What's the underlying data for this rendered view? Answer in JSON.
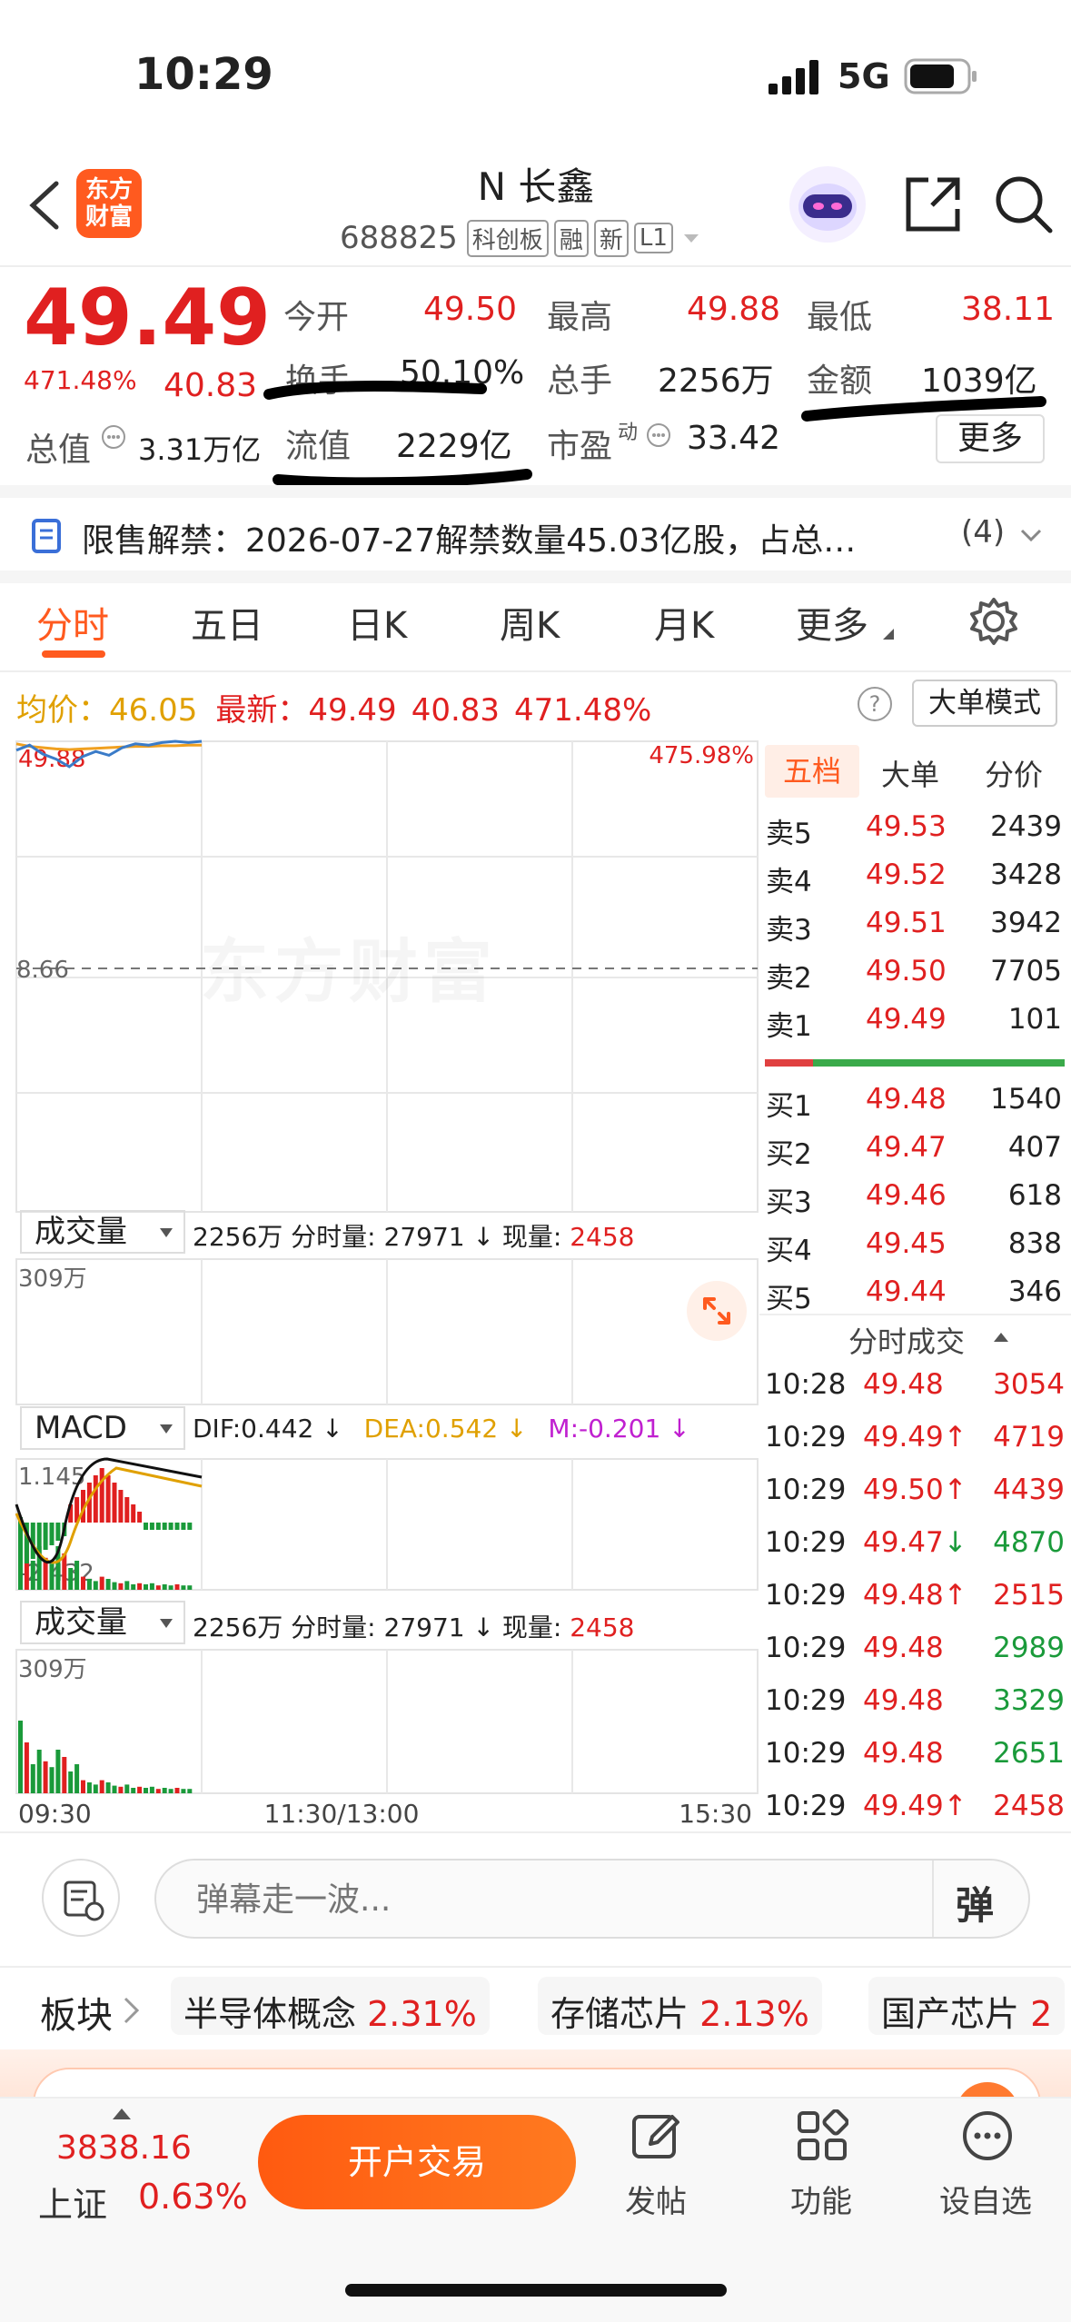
{
  "status": {
    "time": "10:29",
    "network": "5G"
  },
  "header": {
    "title": "N 长鑫",
    "code": "688825",
    "tags": [
      "科创板",
      "融",
      "新",
      "L1"
    ],
    "logo_line1": "东方",
    "logo_line2": "财富"
  },
  "quote": {
    "price": "49.49",
    "change_pct": "471.48%",
    "change": "40.83",
    "open_label": "今开",
    "open": "49.50",
    "high_label": "最高",
    "high": "49.88",
    "low_label": "最低",
    "low": "38.11",
    "turnover_label": "换手",
    "turnover": "50.10%",
    "volume_label": "总手",
    "volume": "2256万",
    "amount_label": "金额",
    "amount": "1039亿",
    "mktcap_label": "总值",
    "mktcap": "3.31万亿",
    "float_label": "流值",
    "float_cap": "2229亿",
    "pe_label": "市盈",
    "pe_sup": "动",
    "pe": "33.42",
    "more": "更多"
  },
  "notice": {
    "text": "限售解禁：2026-07-27解禁数量45.03亿股，占总…",
    "count": "(4)"
  },
  "tabs": [
    "分时",
    "五日",
    "日K",
    "周K",
    "月K",
    "更多"
  ],
  "infobar": {
    "avg_label": "均价：",
    "avg": "46.05",
    "latest_label": "最新：",
    "latest": "49.49",
    "change": "40.83",
    "pct": "471.48%",
    "help": "?",
    "big_order": "大单模式"
  },
  "chart_data": {
    "type": "line",
    "title": "",
    "x_ticks": [
      "09:30",
      "11:30/13:00",
      "15:30"
    ],
    "y_top_label": "49.88",
    "y_mid_label": "8.66",
    "y_top_pct": "475.98%",
    "watermark": "东方财富",
    "vol_panel": {
      "selector": "成交量",
      "total": "2256万",
      "min_vol_label": "分时量:",
      "min_vol": "27971",
      "arrow": "↓",
      "cur_vol_label": "现量:",
      "cur_vol": "2458",
      "ymax": "309万"
    },
    "macd_panel": {
      "selector": "MACD",
      "dif": "DIF:0.442",
      "dif_arrow": "↓",
      "dea": "DEA:0.542",
      "dea_arrow": "↓",
      "m": "M:-0.201",
      "m_arrow": "↓",
      "ymax": "1.145",
      "ymin": "-2.432"
    },
    "price_series": [
      0.93,
      0.97,
      0.9,
      0.86,
      0.8,
      0.88,
      0.92,
      0.89,
      0.95,
      0.98,
      0.97,
      0.99,
      1.0,
      0.99,
      1.0
    ],
    "avg_series": [
      0.98,
      0.96,
      0.95,
      0.94,
      0.935,
      0.94,
      0.945,
      0.95,
      0.955,
      0.96,
      0.96,
      0.965,
      0.965,
      0.97,
      0.97
    ]
  },
  "orderbook": {
    "tabs": [
      "五档",
      "大单",
      "分价"
    ],
    "asks": [
      {
        "label": "卖5",
        "price": "49.53",
        "qty": "2439"
      },
      {
        "label": "卖4",
        "price": "49.52",
        "qty": "3428"
      },
      {
        "label": "卖3",
        "price": "49.51",
        "qty": "3942"
      },
      {
        "label": "卖2",
        "price": "49.50",
        "qty": "7705"
      },
      {
        "label": "卖1",
        "price": "49.49",
        "qty": "101"
      }
    ],
    "bids": [
      {
        "label": "买1",
        "price": "49.48",
        "qty": "1540"
      },
      {
        "label": "买2",
        "price": "49.47",
        "qty": "407"
      },
      {
        "label": "买3",
        "price": "49.46",
        "qty": "618"
      },
      {
        "label": "买4",
        "price": "49.45",
        "qty": "838"
      },
      {
        "label": "买5",
        "price": "49.44",
        "qty": "346"
      }
    ]
  },
  "ticks": {
    "title": "分时成交",
    "rows": [
      {
        "time": "10:28",
        "price": "49.48",
        "dir": "",
        "qty": "3054",
        "qc": "red"
      },
      {
        "time": "10:29",
        "price": "49.49",
        "dir": "↑",
        "qty": "4719",
        "qc": "red"
      },
      {
        "time": "10:29",
        "price": "49.50",
        "dir": "↑",
        "qty": "4439",
        "qc": "red"
      },
      {
        "time": "10:29",
        "price": "49.47",
        "dir": "↓",
        "qty": "4870",
        "qc": "green"
      },
      {
        "time": "10:29",
        "price": "49.48",
        "dir": "↑",
        "qty": "2515",
        "qc": "red"
      },
      {
        "time": "10:29",
        "price": "49.48",
        "dir": "",
        "qty": "2989",
        "qc": "green"
      },
      {
        "time": "10:29",
        "price": "49.48",
        "dir": "",
        "qty": "3329",
        "qc": "green"
      },
      {
        "time": "10:29",
        "price": "49.48",
        "dir": "",
        "qty": "2651",
        "qc": "green"
      },
      {
        "time": "10:29",
        "price": "49.49",
        "dir": "↑",
        "qty": "2458",
        "qc": "red"
      }
    ]
  },
  "danmu": {
    "placeholder": "弹幕走一波...",
    "send": "弹"
  },
  "sectors": {
    "label": "板块",
    "items": [
      {
        "name": "半导体概念",
        "pct": "2.31%"
      },
      {
        "name": "存储芯片",
        "pct": "2.13%"
      },
      {
        "name": "国产芯片",
        "pct": "2"
      }
    ]
  },
  "bottom": {
    "index_value": "3838.16",
    "index_name": "上证",
    "index_pct": "0.63%",
    "trade": "开户交易",
    "post": "发帖",
    "func": "功能",
    "fav": "设自选"
  },
  "colors": {
    "red": "#e02020",
    "green": "#1a9a3a",
    "orange": "#ff6a00"
  }
}
